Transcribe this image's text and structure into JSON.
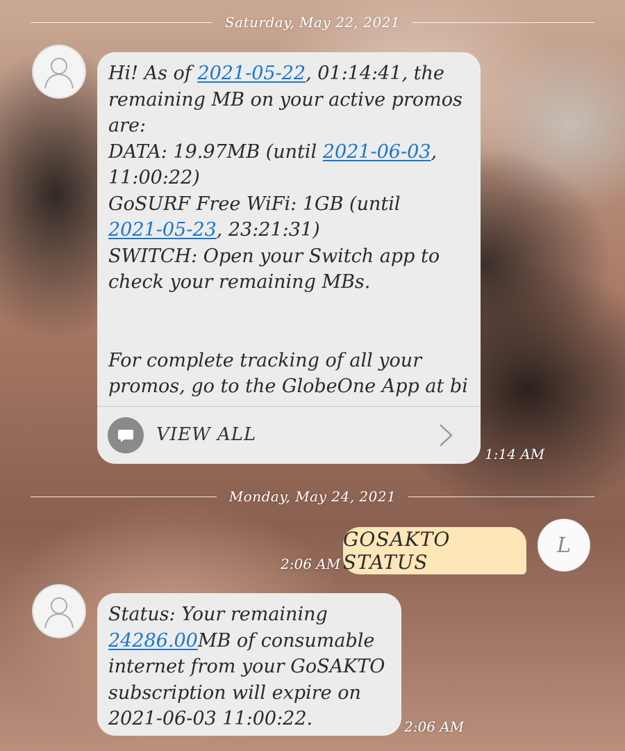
{
  "dates": {
    "first": "Saturday, May 22, 2021",
    "second": "Monday, May 24, 2021"
  },
  "message1": {
    "text_a": "Hi! As of ",
    "link_a": "2021-05-22",
    "text_b": ", 01:14:41, the\nremaining MB on your active promos\nare:\nDATA: 19.97MB (until ",
    "link_b": "2021-06-03",
    "text_c": ",\n11:00:22)\nGoSURF Free WiFi: 1GB (until\n",
    "link_c": "2021-05-23",
    "text_d": ", 23:21:31)\nSWITCH: Open your Switch app to\ncheck your remaining MBs.\n\n\nFor complete tracking of all your\npromos, go to the GlobeOne App at bi",
    "view_all_label": "VIEW ALL",
    "time": "1:14 AM"
  },
  "sent_message": {
    "text": "GOSAKTO STATUS",
    "time": "2:06 AM",
    "avatar_letter": "L"
  },
  "message2": {
    "text_a": "Status: Your remaining\n",
    "link_a": "24286.00",
    "text_b": "MB of consumable\ninternet from your GoSAKTO\nsubscription will expire on\n2021-06-03 11:00:22.",
    "time": "2:06 AM"
  },
  "icons": {
    "contact_avatar": "person-icon",
    "view_all": "chat-bubble-icon",
    "chevron": "chevron-right-icon"
  },
  "colors": {
    "link": "#1976d2",
    "received_bubble": "#ececec",
    "sent_bubble": "#fde6b8"
  }
}
